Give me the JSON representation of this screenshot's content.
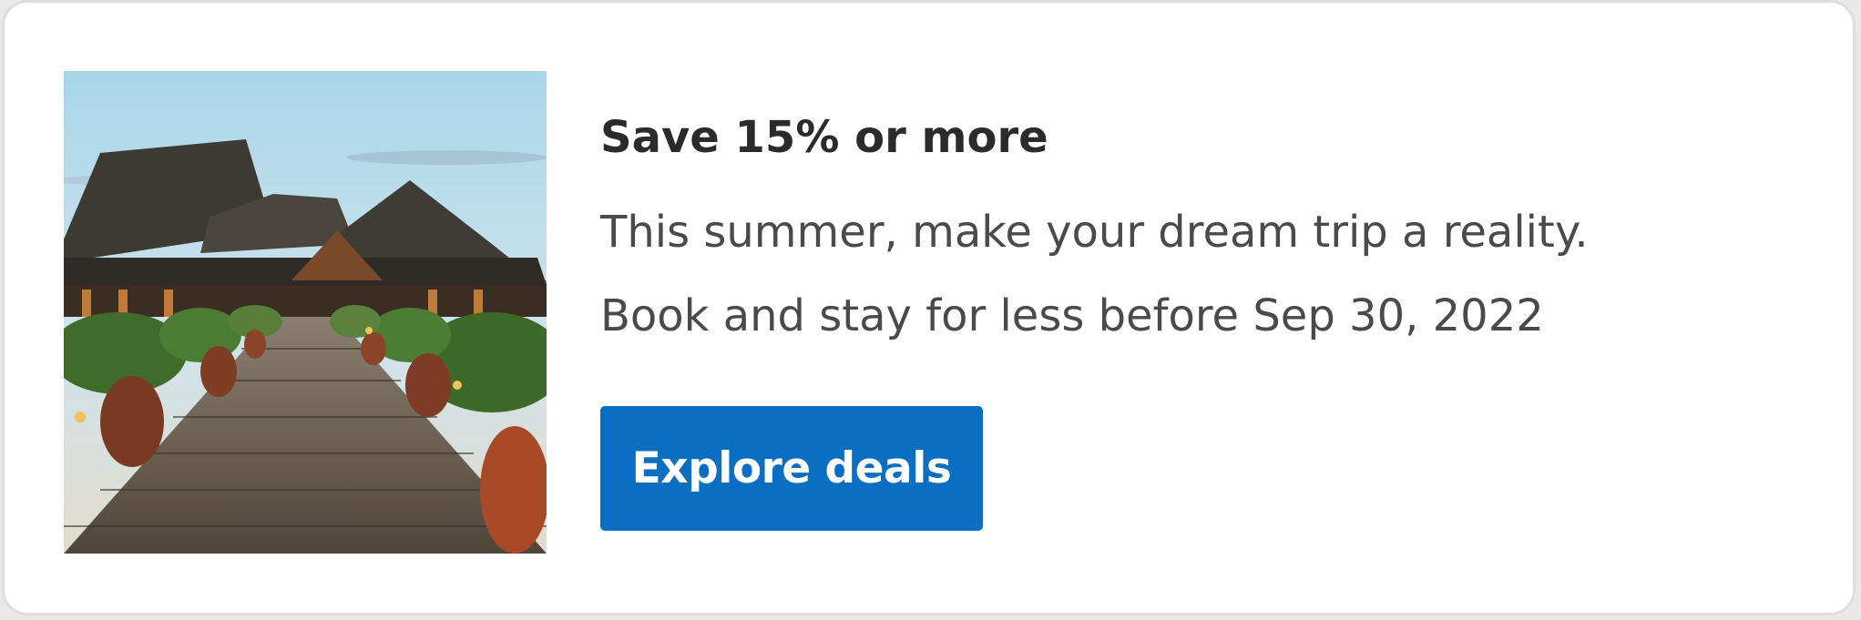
{
  "promo": {
    "headline": "Save 15% or more",
    "description_line1": "This summer, make your dream trip a reality.",
    "description_line2": "Book and stay for less before Sep 30, 2022",
    "cta_label": "Explore deals",
    "image": "resort-pier-photo"
  },
  "colors": {
    "cta_background": "#0a6ec2",
    "cta_text": "#ffffff",
    "headline_text": "#2b2b2b",
    "body_text": "#4a4a4a",
    "card_background": "#ffffff"
  }
}
